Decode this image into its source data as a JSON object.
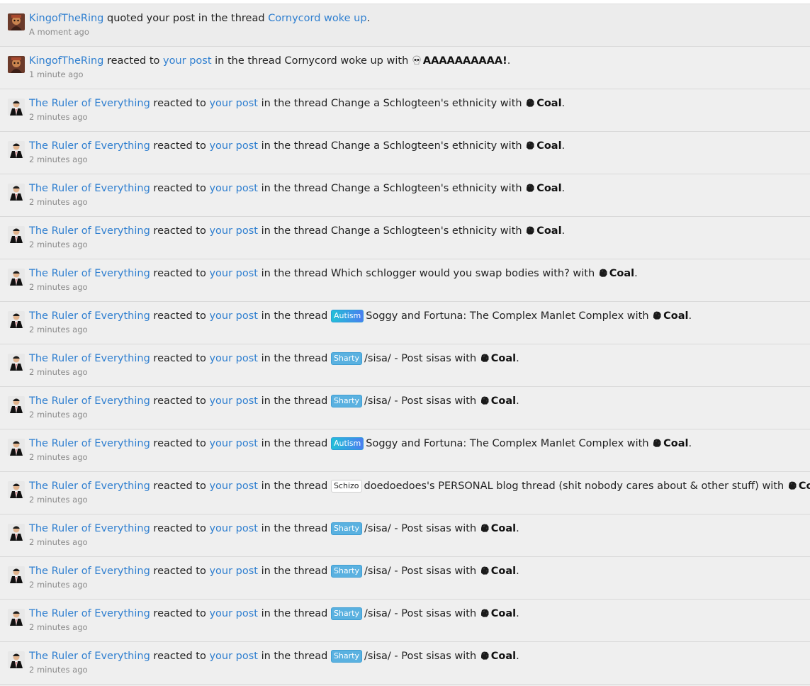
{
  "connectors": {
    "quoted": " quoted your post in the thread ",
    "reacted": " reacted to ",
    "in_thread": " in the thread ",
    "with": " with ",
    "period": "."
  },
  "notifications": [
    {
      "user": "KingofTheRing",
      "avatar": "king-avatar",
      "type": "quote",
      "post_link": "",
      "thread": "Cornycord woke up",
      "thread_is_link": true,
      "prefix": null,
      "reaction": null,
      "reaction_icon": null,
      "time": "A moment ago"
    },
    {
      "user": "KingofTheRing",
      "avatar": "king-avatar",
      "type": "reaction",
      "post_link": "your post",
      "thread": "Cornycord woke up",
      "thread_is_link": false,
      "prefix": null,
      "reaction": "AAAAAAAAAA!",
      "reaction_icon": "skull-icon",
      "time": "1 minute ago"
    },
    {
      "user": "The Ruler of Everything",
      "avatar": "ruler-avatar",
      "type": "reaction",
      "post_link": "your post",
      "thread": "Change a Schlogteen's ethnicity",
      "thread_is_link": false,
      "prefix": null,
      "reaction": "Coal",
      "reaction_icon": "coal-icon",
      "time": "2 minutes ago"
    },
    {
      "user": "The Ruler of Everything",
      "avatar": "ruler-avatar",
      "type": "reaction",
      "post_link": "your post",
      "thread": "Change a Schlogteen's ethnicity",
      "thread_is_link": false,
      "prefix": null,
      "reaction": "Coal",
      "reaction_icon": "coal-icon",
      "time": "2 minutes ago"
    },
    {
      "user": "The Ruler of Everything",
      "avatar": "ruler-avatar",
      "type": "reaction",
      "post_link": "your post",
      "thread": "Change a Schlogteen's ethnicity",
      "thread_is_link": false,
      "prefix": null,
      "reaction": "Coal",
      "reaction_icon": "coal-icon",
      "time": "2 minutes ago"
    },
    {
      "user": "The Ruler of Everything",
      "avatar": "ruler-avatar",
      "type": "reaction",
      "post_link": "your post",
      "thread": "Change a Schlogteen's ethnicity",
      "thread_is_link": false,
      "prefix": null,
      "reaction": "Coal",
      "reaction_icon": "coal-icon",
      "time": "2 minutes ago"
    },
    {
      "user": "The Ruler of Everything",
      "avatar": "ruler-avatar",
      "type": "reaction",
      "post_link": "your post",
      "thread": "Which schlogger would you swap bodies with?",
      "thread_is_link": false,
      "prefix": null,
      "reaction": "Coal",
      "reaction_icon": "coal-icon",
      "time": "2 minutes ago"
    },
    {
      "user": "The Ruler of Everything",
      "avatar": "ruler-avatar",
      "type": "reaction",
      "post_link": "your post",
      "thread": "Soggy and Fortuna: The Complex Manlet Complex",
      "thread_is_link": false,
      "prefix": {
        "text": "Autism",
        "style": "autism"
      },
      "reaction": "Coal",
      "reaction_icon": "coal-icon",
      "time": "2 minutes ago"
    },
    {
      "user": "The Ruler of Everything",
      "avatar": "ruler-avatar",
      "type": "reaction",
      "post_link": "your post",
      "thread": "/sisa/ - Post sisas",
      "thread_is_link": false,
      "prefix": {
        "text": "Sharty",
        "style": "sharty"
      },
      "reaction": "Coal",
      "reaction_icon": "coal-icon",
      "time": "2 minutes ago"
    },
    {
      "user": "The Ruler of Everything",
      "avatar": "ruler-avatar",
      "type": "reaction",
      "post_link": "your post",
      "thread": "/sisa/ - Post sisas",
      "thread_is_link": false,
      "prefix": {
        "text": "Sharty",
        "style": "sharty"
      },
      "reaction": "Coal",
      "reaction_icon": "coal-icon",
      "time": "2 minutes ago"
    },
    {
      "user": "The Ruler of Everything",
      "avatar": "ruler-avatar",
      "type": "reaction",
      "post_link": "your post",
      "thread": "Soggy and Fortuna: The Complex Manlet Complex",
      "thread_is_link": false,
      "prefix": {
        "text": "Autism",
        "style": "autism"
      },
      "reaction": "Coal",
      "reaction_icon": "coal-icon",
      "time": "2 minutes ago"
    },
    {
      "user": "The Ruler of Everything",
      "avatar": "ruler-avatar",
      "type": "reaction",
      "post_link": "your post",
      "thread": "doedoedoes's PERSONAL blog thread (shit nobody cares about & other stuff)",
      "thread_is_link": false,
      "prefix": {
        "text": "Schizo",
        "style": "schizo"
      },
      "reaction": "Coal",
      "reaction_icon": "coal-icon",
      "time": "2 minutes ago"
    },
    {
      "user": "The Ruler of Everything",
      "avatar": "ruler-avatar",
      "type": "reaction",
      "post_link": "your post",
      "thread": "/sisa/ - Post sisas",
      "thread_is_link": false,
      "prefix": {
        "text": "Sharty",
        "style": "sharty"
      },
      "reaction": "Coal",
      "reaction_icon": "coal-icon",
      "time": "2 minutes ago"
    },
    {
      "user": "The Ruler of Everything",
      "avatar": "ruler-avatar",
      "type": "reaction",
      "post_link": "your post",
      "thread": "/sisa/ - Post sisas",
      "thread_is_link": false,
      "prefix": {
        "text": "Sharty",
        "style": "sharty"
      },
      "reaction": "Coal",
      "reaction_icon": "coal-icon",
      "time": "2 minutes ago"
    },
    {
      "user": "The Ruler of Everything",
      "avatar": "ruler-avatar",
      "type": "reaction",
      "post_link": "your post",
      "thread": "/sisa/ - Post sisas",
      "thread_is_link": false,
      "prefix": {
        "text": "Sharty",
        "style": "sharty"
      },
      "reaction": "Coal",
      "reaction_icon": "coal-icon",
      "time": "2 minutes ago"
    },
    {
      "user": "The Ruler of Everything",
      "avatar": "ruler-avatar",
      "type": "reaction",
      "post_link": "your post",
      "thread": "/sisa/ - Post sisas",
      "thread_is_link": false,
      "prefix": {
        "text": "Sharty",
        "style": "sharty"
      },
      "reaction": "Coal",
      "reaction_icon": "coal-icon",
      "time": "2 minutes ago"
    }
  ],
  "colors": {
    "link": "#2f7fd0",
    "time": "#8b8b8b",
    "sharty": "#5ab1e0",
    "autism": "#2b9ad9"
  }
}
